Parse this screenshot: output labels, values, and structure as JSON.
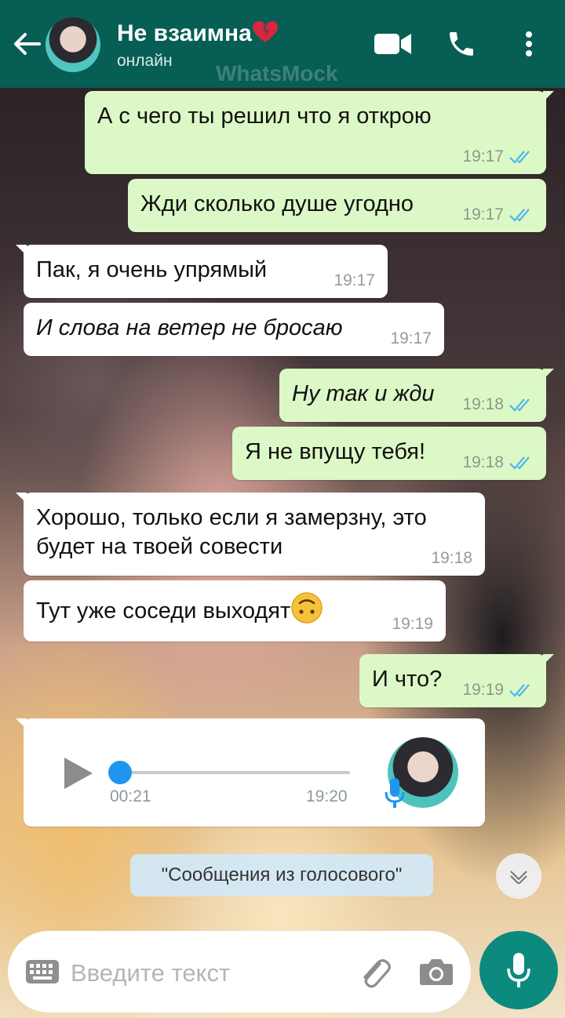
{
  "watermark": "WhatsMock",
  "header": {
    "contact_name": "Не взаимна",
    "status": "онлайн"
  },
  "messages": [
    {
      "dir": "out",
      "text": "А с чего ты решил что я открою",
      "time": "19:17",
      "italic": false
    },
    {
      "dir": "out",
      "text": "Жди сколько душе угодно",
      "time": "19:17",
      "italic": false
    },
    {
      "dir": "in",
      "text": "Пак, я очень упрямый",
      "time": "19:17",
      "italic": false
    },
    {
      "dir": "in",
      "text": "И слова на ветер не бросаю",
      "time": "19:17",
      "italic": true
    },
    {
      "dir": "out",
      "text": "Ну так и жди",
      "time": "19:18",
      "italic": true
    },
    {
      "dir": "out",
      "text": "Я не впущу тебя!",
      "time": "19:18",
      "italic": false
    },
    {
      "dir": "in",
      "text": "Хорошо, только если я замерзну, это будет на твоей совести",
      "time": "19:18",
      "italic": false
    },
    {
      "dir": "in",
      "text": "Тут уже соседи выходят",
      "time": "19:19",
      "italic": false,
      "emoji": "upside-down-face"
    },
    {
      "dir": "out",
      "text": "И что?",
      "time": "19:19",
      "italic": false
    }
  ],
  "voice_message": {
    "duration": "00:21",
    "time": "19:20",
    "progress": 0.0
  },
  "transcription_label": "\"Сообщения из голосового\"",
  "input": {
    "placeholder": "Введите текст"
  },
  "colors": {
    "header": "#075e54",
    "outgoing_bubble": "#dcf8c6",
    "incoming_bubble": "#ffffff",
    "read_ticks": "#4fb6ec",
    "mic_button": "#0d8a7e"
  }
}
